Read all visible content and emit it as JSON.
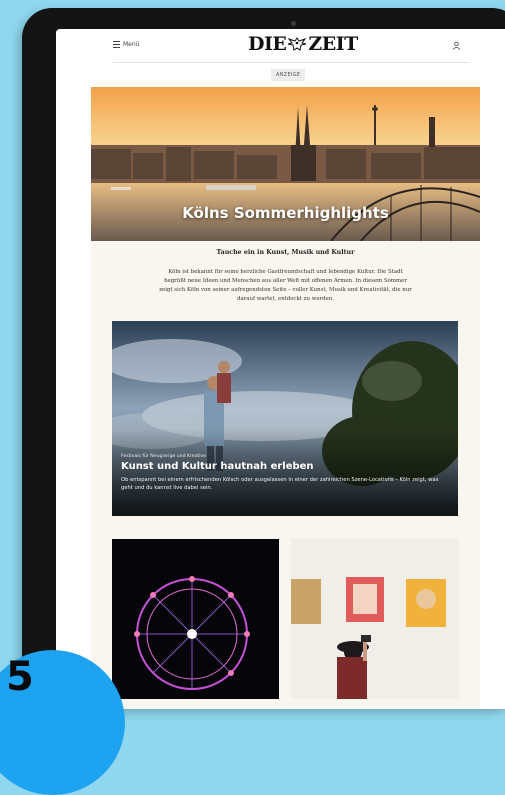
{
  "header": {
    "menu_label": "Menü",
    "logo_left": "DIE",
    "logo_right": "ZEIT",
    "ad_label": "ANZEIGE"
  },
  "hero": {
    "title": "Kölns Sommerhighlights"
  },
  "intro": {
    "subhead": "Tauche ein in Kunst, Musik und Kultur",
    "body": "Köln ist bekannt für seine herzliche Gastfreundschaft und lebendige Kultur. Die Stadt begrüßt neue Ideen und Menschen aus aller Welt mit offenen Armen. In diesem Sommer zeigt sich Köln von seiner aufregendsten Seite – voller Kunst, Musik und Kreativität, die nur darauf wartet, entdeckt zu werden."
  },
  "feature": {
    "kicker": "Festivals für Neugierige und Kreative",
    "title": "Kunst und Kultur hautnah erleben",
    "description": "Ob entspannt bei einem erfrischenden Kölsch oder ausgelassen in einer der zahlreichen Szene-Locations – Köln zeigt, was geht und du kannst live dabei sein."
  },
  "badge": {
    "number": "5"
  },
  "icons": {
    "menu": "hamburger-icon",
    "user": "user-icon",
    "crest": "eagle-crest-icon"
  },
  "colors": {
    "background": "#8fd7ee",
    "badge": "#1ea3f0",
    "article_bg": "#f8f6ee"
  }
}
